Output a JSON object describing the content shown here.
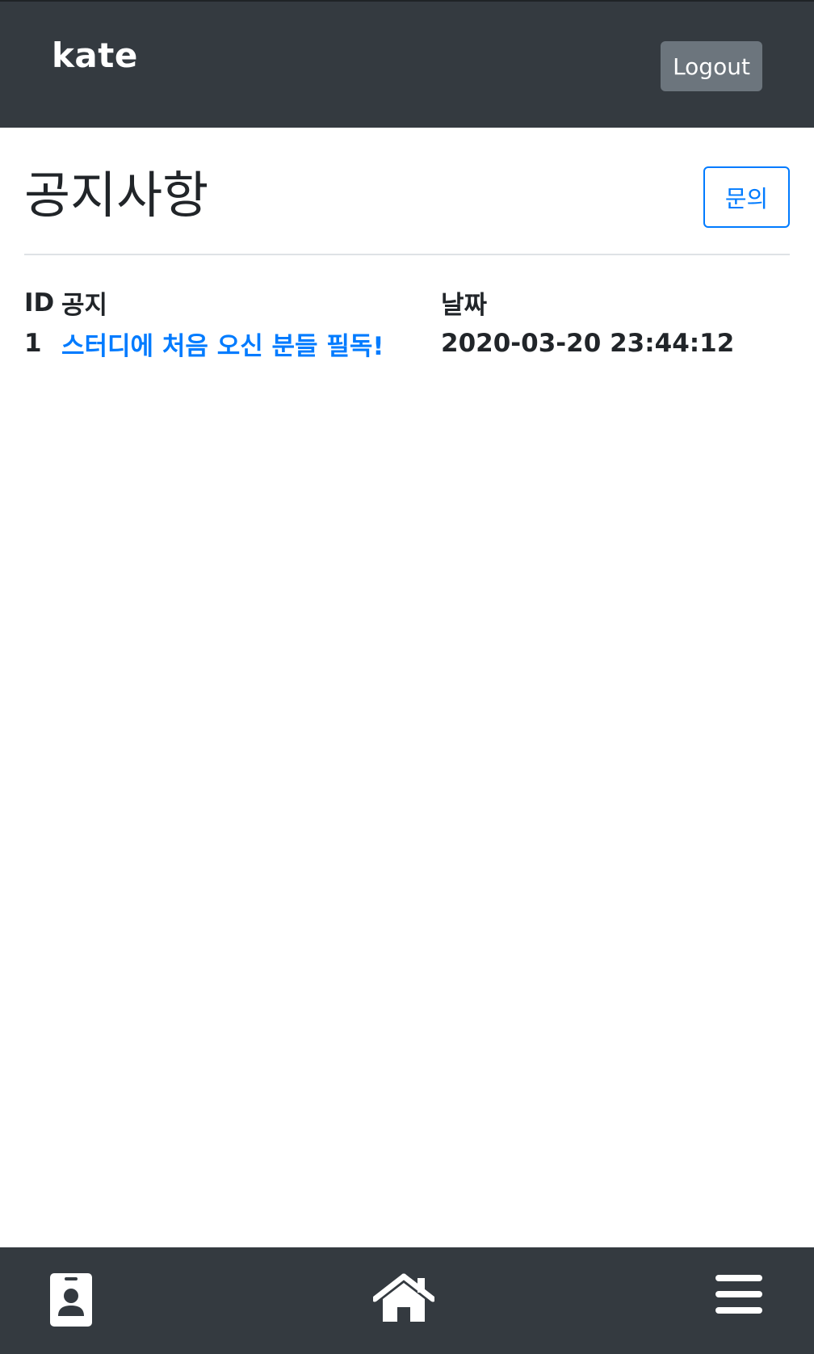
{
  "header": {
    "brand": "kate",
    "logout_label": "Logout"
  },
  "main": {
    "title": "공지사항",
    "inquiry_label": "문의",
    "table": {
      "columns": [
        "ID",
        "공지",
        "날짜"
      ],
      "rows": [
        {
          "id": "1",
          "title": "스터디에 처음 오신 분들 필독!",
          "date": "2020-03-20 23:44:12"
        }
      ]
    }
  },
  "bottom_nav": {
    "items": [
      {
        "icon": "id-badge-icon"
      },
      {
        "icon": "home-icon"
      },
      {
        "icon": "menu-icon"
      }
    ]
  },
  "colors": {
    "navbar": "#343a40",
    "logout_button": "#6c757d",
    "link": "#007bff"
  }
}
